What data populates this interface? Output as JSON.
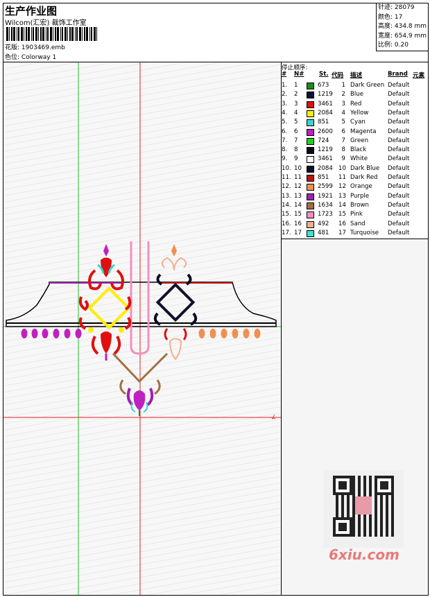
{
  "header": {
    "title": "生产作业图",
    "company": "Wilcom(汇宏) 裁饰工作室",
    "design_label": "花版:",
    "design_file": "1903469.emb",
    "colorway_label": "色位:",
    "colorway": "Colorway 1"
  },
  "stats": {
    "stitches": "针迹: 28079",
    "colors": "颜色: 17",
    "height": "高度: 434.8 mm",
    "width": "宽度: 654.9 mm",
    "scale": "比例: 0.20"
  },
  "stop_sequence": {
    "label": "停止顺序:",
    "headers": [
      "#",
      "N#",
      "St.",
      "代码",
      "描述",
      "Brand",
      "元素"
    ],
    "rows": [
      {
        "num": "1.",
        "n": "1",
        "color": "#1a8a1a",
        "st": "673",
        "code": "1",
        "desc": "Dark Green",
        "brand": "Default"
      },
      {
        "num": "2.",
        "n": "2",
        "color": "#10103a",
        "st": "1219",
        "code": "2",
        "desc": "Blue",
        "brand": "Default"
      },
      {
        "num": "3.",
        "n": "3",
        "color": "#e01010",
        "st": "3461",
        "code": "3",
        "desc": "Red",
        "brand": "Default"
      },
      {
        "num": "4.",
        "n": "4",
        "color": "#ffee00",
        "st": "2084",
        "code": "4",
        "desc": "Yellow",
        "brand": "Default"
      },
      {
        "num": "5.",
        "n": "5",
        "color": "#40d0d0",
        "st": "851",
        "code": "5",
        "desc": "Cyan",
        "brand": "Default"
      },
      {
        "num": "6.",
        "n": "6",
        "color": "#c020c0",
        "st": "2600",
        "code": "6",
        "desc": "Magenta",
        "brand": "Default"
      },
      {
        "num": "7.",
        "n": "7",
        "color": "#20d020",
        "st": "724",
        "code": "7",
        "desc": "Green",
        "brand": "Default"
      },
      {
        "num": "8.",
        "n": "8",
        "color": "#0a0a20",
        "st": "1219",
        "code": "8",
        "desc": "Black",
        "brand": "Default"
      },
      {
        "num": "9.",
        "n": "9",
        "color": "#ffffff",
        "st": "3461",
        "code": "9",
        "desc": "White",
        "brand": "Default"
      },
      {
        "num": "10.",
        "n": "10",
        "color": "#10102a",
        "st": "2084",
        "code": "10",
        "desc": "Dark Blue",
        "brand": "Default"
      },
      {
        "num": "11.",
        "n": "11",
        "color": "#c01010",
        "st": "851",
        "code": "11",
        "desc": "Dark Red",
        "brand": "Default"
      },
      {
        "num": "12.",
        "n": "12",
        "color": "#f09050",
        "st": "2599",
        "code": "12",
        "desc": "Orange",
        "brand": "Default"
      },
      {
        "num": "13.",
        "n": "13",
        "color": "#a020b0",
        "st": "1921",
        "code": "13",
        "desc": "Purple",
        "brand": "Default"
      },
      {
        "num": "14.",
        "n": "14",
        "color": "#a07040",
        "st": "1634",
        "code": "14",
        "desc": "Brown",
        "brand": "Default"
      },
      {
        "num": "15.",
        "n": "15",
        "color": "#f090c0",
        "st": "1723",
        "code": "15",
        "desc": "Pink",
        "brand": "Default"
      },
      {
        "num": "16.",
        "n": "16",
        "color": "#f0b090",
        "st": "492",
        "code": "16",
        "desc": "Sand",
        "brand": "Default"
      },
      {
        "num": "17.",
        "n": "17",
        "color": "#40e0d0",
        "st": "481",
        "code": "17",
        "desc": "Turquoise",
        "brand": "Default"
      }
    ]
  },
  "watermark": {
    "site": "6xiu.com"
  },
  "colors": {
    "guide_green": "#20c020",
    "guide_red": "#e02020"
  }
}
